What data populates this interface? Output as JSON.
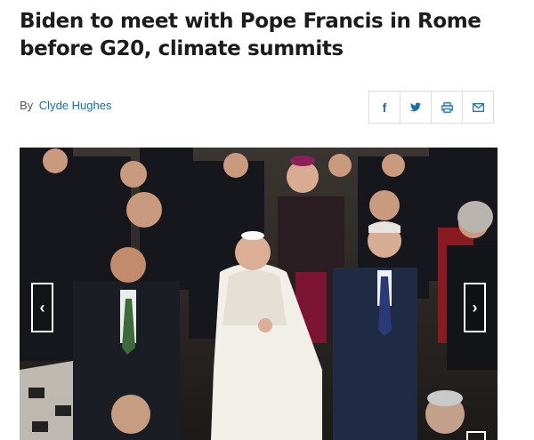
{
  "article": {
    "headline": "Biden to meet with Pope Francis in Rome before G20, climate summits",
    "byline_prefix": "By",
    "author": "Clyde Hughes"
  },
  "share": {
    "facebook_glyph": "f",
    "twitter_icon": "twitter-icon",
    "print_icon": "print-icon",
    "email_icon": "email-icon"
  },
  "gallery": {
    "image_subject": "photo-pope-francis-and-biden",
    "prev_glyph": "‹",
    "next_glyph": "›",
    "expand_icon": "expand-icon"
  },
  "colors": {
    "link": "#1b6fa8",
    "headline": "#1c1c1c",
    "border": "#dddddd"
  }
}
